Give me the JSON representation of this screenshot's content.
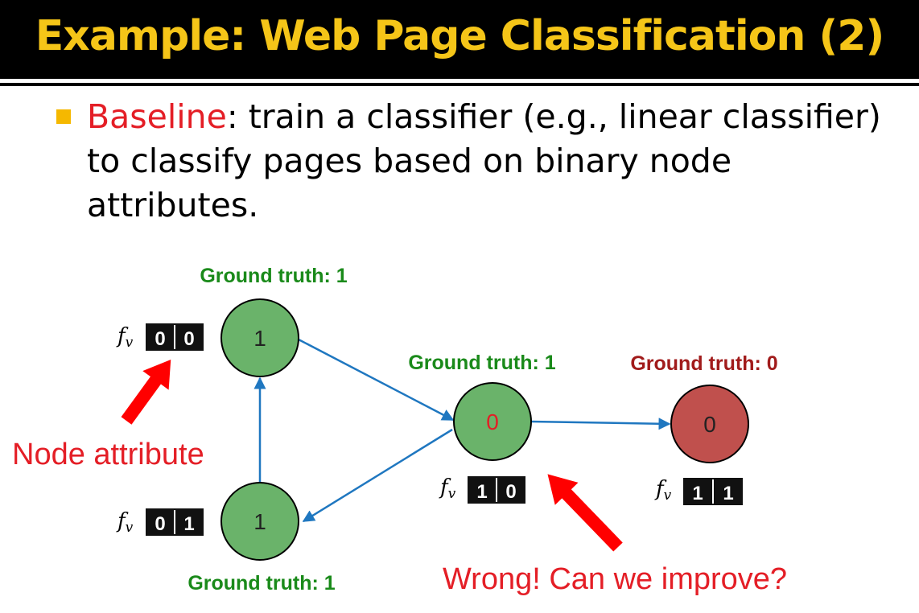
{
  "slide": {
    "title": "Example: Web Page Classification (2)",
    "bullet": {
      "highlight": "Baseline",
      "text": ": train a classifier (e.g., linear classifier) to classify pages based on binary node attributes."
    }
  },
  "colors": {
    "title": "#F5C518",
    "highlight": "#E41E26",
    "node_correct": "#6AB36A",
    "node_wrong": "#C0504D",
    "edge": "#1F77C0",
    "label_correct": "#1A8A1A",
    "label_wrong": "#A11B1B",
    "arrow": "#FF0000"
  },
  "diagram": {
    "feature_symbol": "f",
    "feature_subscript": "v",
    "nodes": [
      {
        "id": "top-left",
        "prediction": "1",
        "ground_truth_label": "Ground truth: 1",
        "features": [
          "0",
          "0"
        ],
        "status": "correct"
      },
      {
        "id": "bottom-left",
        "prediction": "1",
        "ground_truth_label": "Ground truth: 1",
        "features": [
          "0",
          "1"
        ],
        "status": "correct"
      },
      {
        "id": "middle",
        "prediction": "0",
        "ground_truth_label": "Ground truth: 1",
        "features": [
          "1",
          "0"
        ],
        "status": "correct"
      },
      {
        "id": "right",
        "prediction": "0",
        "ground_truth_label": "Ground truth: 0",
        "features": [
          "1",
          "1"
        ],
        "status": "wrong"
      }
    ],
    "edges": [
      {
        "from": "top-left",
        "to": "middle"
      },
      {
        "from": "bottom-left",
        "to": "top-left"
      },
      {
        "from": "middle",
        "to": "bottom-left"
      },
      {
        "from": "middle",
        "to": "right"
      }
    ],
    "annotations": {
      "node_attribute": "Node attribute",
      "wrong": "Wrong! Can we improve?"
    }
  }
}
